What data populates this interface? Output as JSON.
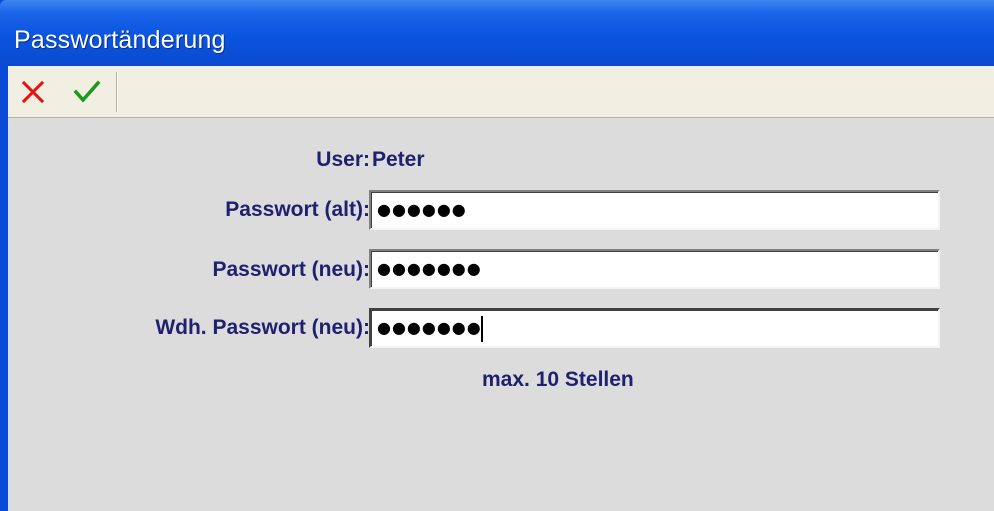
{
  "window": {
    "title": "Passwortänderung"
  },
  "toolbar": {
    "cancel_icon": "red-x-icon",
    "confirm_icon": "green-check-icon",
    "colors": {
      "cancel": "#e81010",
      "confirm": "#1a9a1a"
    }
  },
  "form": {
    "user_label": "User:",
    "user_value": "Peter",
    "old_password_label": "Passwort (alt):",
    "old_password_value": "●●●●●●",
    "new_password_label": "Passwort (neu):",
    "new_password_value": "●●●●●●●",
    "repeat_password_label": "Wdh. Passwort (neu):",
    "repeat_password_value": "●●●●●●●",
    "hint": "max. 10 Stellen"
  }
}
